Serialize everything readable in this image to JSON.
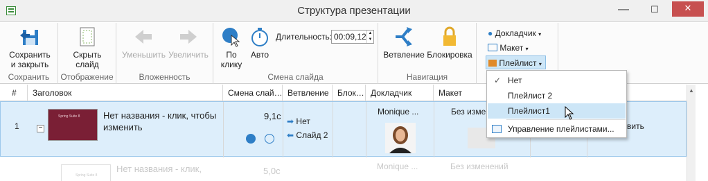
{
  "window": {
    "title": "Структура презентации",
    "min": "—",
    "max": "☐",
    "close": "✕"
  },
  "ribbon": {
    "groups": {
      "save": "Сохранить",
      "display": "Отображение",
      "nesting": "Вложенность",
      "slide_change": "Смена слайда",
      "navigation": "Навигация"
    },
    "save_close": "Сохранить\nи закрыть",
    "hide_slide": "Скрыть\nслайд",
    "decrease": "Уменьшить",
    "increase": "Увеличить",
    "on_click": "По\nклику",
    "auto": "Авто",
    "duration_label": "Длительность:",
    "duration_value": "00:09,12",
    "branching": "Ветвление",
    "lock": "Блокировка",
    "presenter": "Докладчик",
    "layout": "Макет",
    "playlist": "Плейлист"
  },
  "columns": [
    "#",
    "Заголовок",
    "Смена слай…",
    "Ветвление",
    "Блок…",
    "Докладчик",
    "Макет"
  ],
  "rows": [
    {
      "num": "1",
      "title": "Нет названия - клик, чтобы изменить",
      "time": "9,1с",
      "branch_next": "Нет",
      "branch_prev": "Слайд 2",
      "presenter": "Monique ...",
      "layout": "Без изменений",
      "extra": "вить",
      "thumb_title": "Spring Suite 8"
    },
    {
      "num": "",
      "title": "Нет названия - клик,",
      "time": "5,0с",
      "presenter": "Monique ...",
      "layout": "Без изменений",
      "thumb_title": "Spring Suite 8"
    }
  ],
  "menu": {
    "items": [
      "Нет",
      "Плейлист 2",
      "Плейлист1",
      "Управление плейлистами..."
    ]
  },
  "colors": {
    "accent": "#2e7ec6",
    "thumb": "#7a1f35",
    "selection": "#ddeefb",
    "menu_hl": "#cde6f7"
  }
}
